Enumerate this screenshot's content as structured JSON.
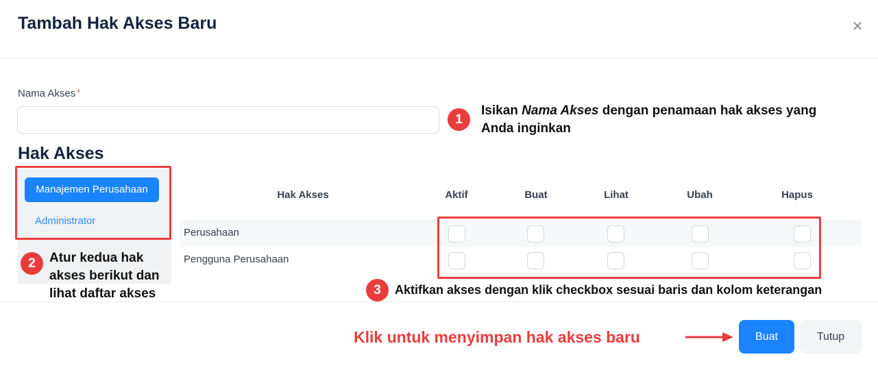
{
  "modal": {
    "title": "Tambah Hak Akses Baru",
    "close_icon": "close-icon"
  },
  "form": {
    "name_label": "Nama Akses",
    "required_mark": "*",
    "name_value": "",
    "name_placeholder": ""
  },
  "access": {
    "section_title": "Hak Akses",
    "tabs": [
      {
        "label": "Manajemen Perusahaan",
        "active": true
      },
      {
        "label": "Administrator",
        "active": false
      }
    ],
    "columns": [
      "Hak Akses",
      "Aktif",
      "Buat",
      "Lihat",
      "Ubah",
      "Hapus"
    ],
    "rows": [
      {
        "label": "Perusahaan",
        "aktif": false,
        "buat": false,
        "lihat": false,
        "ubah": false,
        "hapus": false
      },
      {
        "label": "Pengguna Perusahaan",
        "aktif": false,
        "buat": false,
        "lihat": false,
        "ubah": false,
        "hapus": false
      }
    ]
  },
  "annotations": {
    "step1": {
      "number": "1",
      "text_before": "Isikan ",
      "text_em": "Nama Akses",
      "text_after": " dengan penamaan hak akses yang Anda inginkan"
    },
    "step2": {
      "number": "2",
      "text": "Atur kedua hak akses berikut dan lihat daftar akses"
    },
    "step3": {
      "number": "3",
      "text": "Aktifkan akses dengan klik checkbox sesuai baris dan kolom keterangan"
    },
    "cta": "Klik untuk menyimpan hak akses baru",
    "highlight_color": "#ef3e3e"
  },
  "footer": {
    "submit_label": "Buat",
    "close_label": "Tutup"
  },
  "colors": {
    "primary": "#1a84ff",
    "title": "#15233d",
    "annotation_red": "#e93c3c"
  }
}
